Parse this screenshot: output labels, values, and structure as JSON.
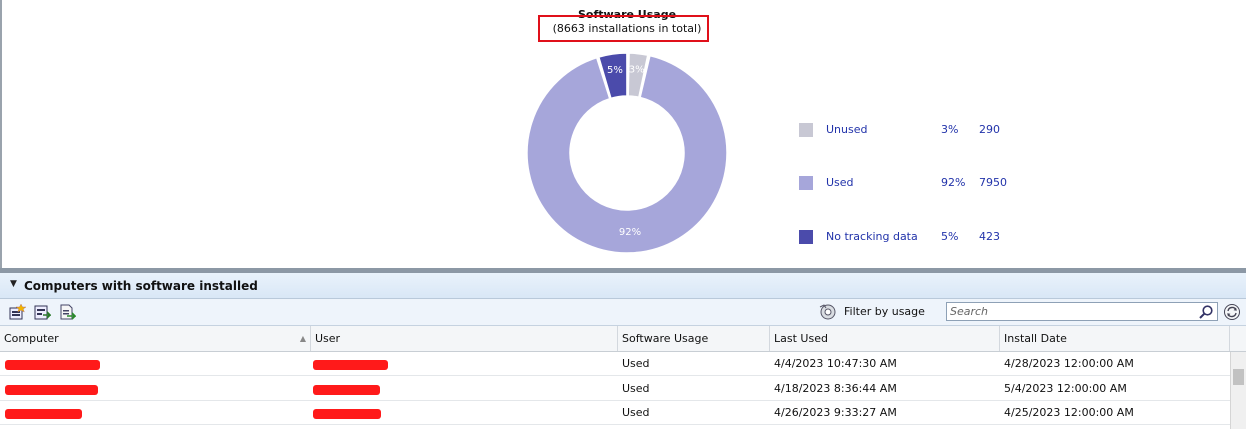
{
  "chart": {
    "title": "Software Usage",
    "subtitle": "(8663 installations in total)"
  },
  "chart_data": {
    "type": "pie",
    "title": "Software Usage",
    "subtitle": "(8663 installations in total)",
    "donut": true,
    "legend_position": "right",
    "slices": [
      {
        "name": "Unused",
        "percent_label": "3%",
        "percent": 3,
        "count": 290,
        "color": "#c8c8d4"
      },
      {
        "name": "Used",
        "percent_label": "92%",
        "percent": 92,
        "count": 7950,
        "color": "#a6a6da"
      },
      {
        "name": "No tracking data",
        "percent_label": "5%",
        "percent": 5,
        "count": 423,
        "color": "#4b4bab"
      }
    ]
  },
  "legend": [
    {
      "label": "Unused",
      "percent": "3%",
      "count": "290",
      "color": "#c8c8d4"
    },
    {
      "label": "Used",
      "percent": "92%",
      "count": "7950",
      "color": "#a6a6da"
    },
    {
      "label": "No tracking data",
      "percent": "5%",
      "count": "423",
      "color": "#4b4bab"
    }
  ],
  "section": {
    "title": "Computers with software installed"
  },
  "toolbar": {
    "icons": [
      "add-to-list-icon",
      "export-icon",
      "report-icon"
    ],
    "filter_label": "Filter by usage",
    "search_placeholder": "Search"
  },
  "grid": {
    "columns": [
      "Computer",
      "User",
      "Software Usage",
      "Last Used",
      "Install Date"
    ],
    "rows": [
      {
        "usage": "Used",
        "last_used": "4/4/2023 10:47:30 AM",
        "install_date": "4/28/2023 12:00:00 AM"
      },
      {
        "usage": "Used",
        "last_used": "4/18/2023 8:36:44 AM",
        "install_date": "5/4/2023 12:00:00 AM"
      },
      {
        "usage": "Used",
        "last_used": "4/26/2023 9:33:27 AM",
        "install_date": "4/25/2023 12:00:00 AM"
      }
    ]
  },
  "colors": {
    "accent_link": "#2233aa",
    "highlight": "#e0101a",
    "redaction": "#ff1a1a"
  }
}
